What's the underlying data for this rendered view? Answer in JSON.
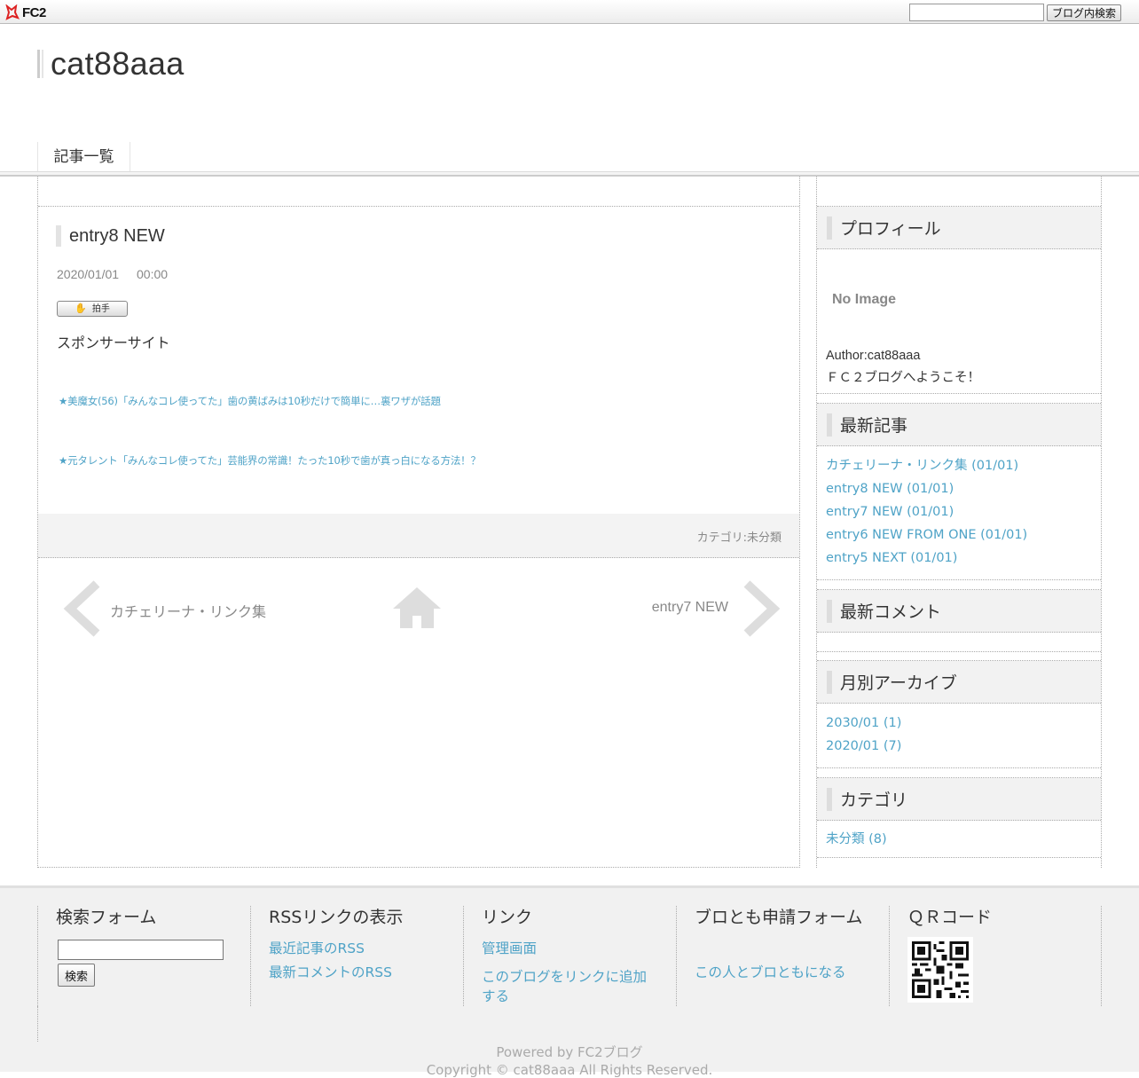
{
  "topbar": {
    "logo_text": "FC2",
    "search_placeholder": "",
    "search_button": "ブログ内検索"
  },
  "header": {
    "blog_title": "cat88aaa",
    "nav_tab": "記事一覧"
  },
  "entry": {
    "title": "entry8 NEW",
    "date": "2020/01/01",
    "time": "00:00",
    "clap_label": "拍手",
    "sponsor_heading": "スポンサーサイト",
    "ad_links": [
      "★美魔女(56)「みんなコレ使ってた」歯の黄ばみは10秒だけで簡単に…裏ワザが話題",
      "★元タレント「みんなコレ使ってた」芸能界の常識！たった10秒で歯が真っ白になる方法！？"
    ],
    "category": "カテゴリ:未分類",
    "prev_label": "カチェリーナ・リンク集",
    "next_label": "entry7 NEW"
  },
  "sidebar": {
    "profile": {
      "title": "プロフィール",
      "no_image": "No Image",
      "author": "Author:cat88aaa",
      "message": "ＦＣ２ブログへようこそ！"
    },
    "recent_entries": {
      "title": "最新記事",
      "items": [
        "カチェリーナ・リンク集 (01/01)",
        "entry8 NEW (01/01)",
        "entry7 NEW (01/01)",
        "entry6 NEW FROM ONE (01/01)",
        "entry5 NEXT (01/01)"
      ]
    },
    "recent_comments": {
      "title": "最新コメント"
    },
    "archives": {
      "title": "月別アーカイブ",
      "items": [
        "2030/01 (1)",
        "2020/01 (7)"
      ]
    },
    "categories": {
      "title": "カテゴリ",
      "items": [
        "未分類 (8)"
      ]
    }
  },
  "footer": {
    "search": {
      "title": "検索フォーム",
      "button": "検索"
    },
    "rss": {
      "title": "RSSリンクの表示",
      "links": [
        "最近記事のRSS",
        "最新コメントのRSS"
      ]
    },
    "links": {
      "title": "リンク",
      "items": [
        "管理画面",
        "このブログをリンクに追加する"
      ]
    },
    "friend": {
      "title": "ブロとも申請フォーム",
      "link": "この人とブロともになる"
    },
    "qr": {
      "title": "ＱＲコード"
    },
    "powered": "Powered by FC2ブログ",
    "copyright": "Copyright © cat88aaa All Rights Reserved."
  },
  "colors": {
    "link": "#4fa3c7",
    "text": "#333333",
    "muted": "#888888",
    "panel_bg": "#f2f2f2"
  }
}
